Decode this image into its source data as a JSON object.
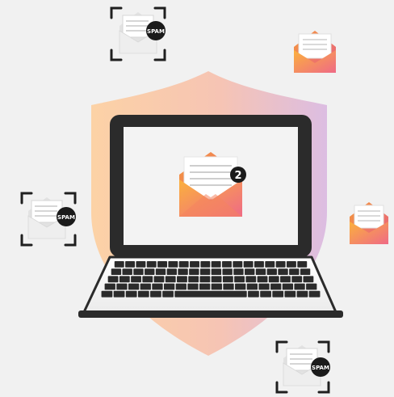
{
  "notification": {
    "count": "2"
  },
  "spam_badges": {
    "label": "SPAM"
  },
  "colors": {
    "background": "#f1f1f1",
    "laptop_frame": "#2b2b2b",
    "screen": "#f3f3f3",
    "envelope_orange": "#f7a23a",
    "envelope_pink": "#ee6c84",
    "shield_orange": "#fbc79a",
    "shield_purple": "#d9b9dc",
    "spam_envelope": "#eeeeee",
    "badge_dark": "#1b1b1b"
  }
}
